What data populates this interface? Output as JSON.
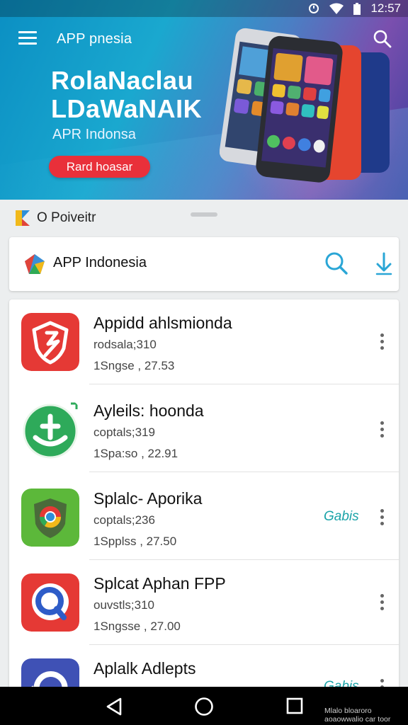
{
  "status_bar": {
    "time": "12:57",
    "colors": {
      "icons": "#ffffff"
    }
  },
  "header": {
    "app_name": "APP pnesia",
    "title_line1": "RolaNaclau",
    "title_line2": "LDaWaNAIK",
    "subtitle": "APR Indonsa",
    "cta_label": "Rard hoasar",
    "colors": {
      "gradient_start": "#0b8fc3",
      "gradient_end": "#3b3f9e",
      "cta": "#e9303a"
    }
  },
  "section": {
    "title": "O Poiveitr"
  },
  "search": {
    "value": "APP Indonesia",
    "accent": "#2aa6d6"
  },
  "apps": [
    {
      "name": "Appidd ahlsmionda",
      "meta1": "rodsala;310",
      "meta2": "1Sngse  ,  27.53",
      "badge": "",
      "icon": "shield-icon",
      "color": "#e53935"
    },
    {
      "name": "Ayleils: hoonda",
      "meta1": "coptals;319",
      "meta2": "1Spa:so  ,  22.91",
      "badge": "",
      "icon": "download-arrow-icon",
      "color": "#2eaa5a"
    },
    {
      "name": "Splalc- Aporika",
      "meta1": "coptals;236",
      "meta2": "1Spplss  ,  27.50",
      "badge": "Gabis",
      "icon": "chrome-shield-icon",
      "color": "#5cb83a"
    },
    {
      "name": "Splcat Aphan FPP",
      "meta1": "ouvstls;310",
      "meta2": "1Sngsse  ,  27.00",
      "badge": "",
      "icon": "q-search-icon",
      "color": "#e53935"
    },
    {
      "name": "Aplalk Adlepts",
      "meta1": "",
      "meta2": "",
      "badge": "Gabis",
      "icon": "refresh-icon",
      "color": "#3f51b5"
    }
  ],
  "navbar": {
    "note_line1": "Mlalo bloaroro",
    "note_line2": "aoaowwalio car toor"
  }
}
